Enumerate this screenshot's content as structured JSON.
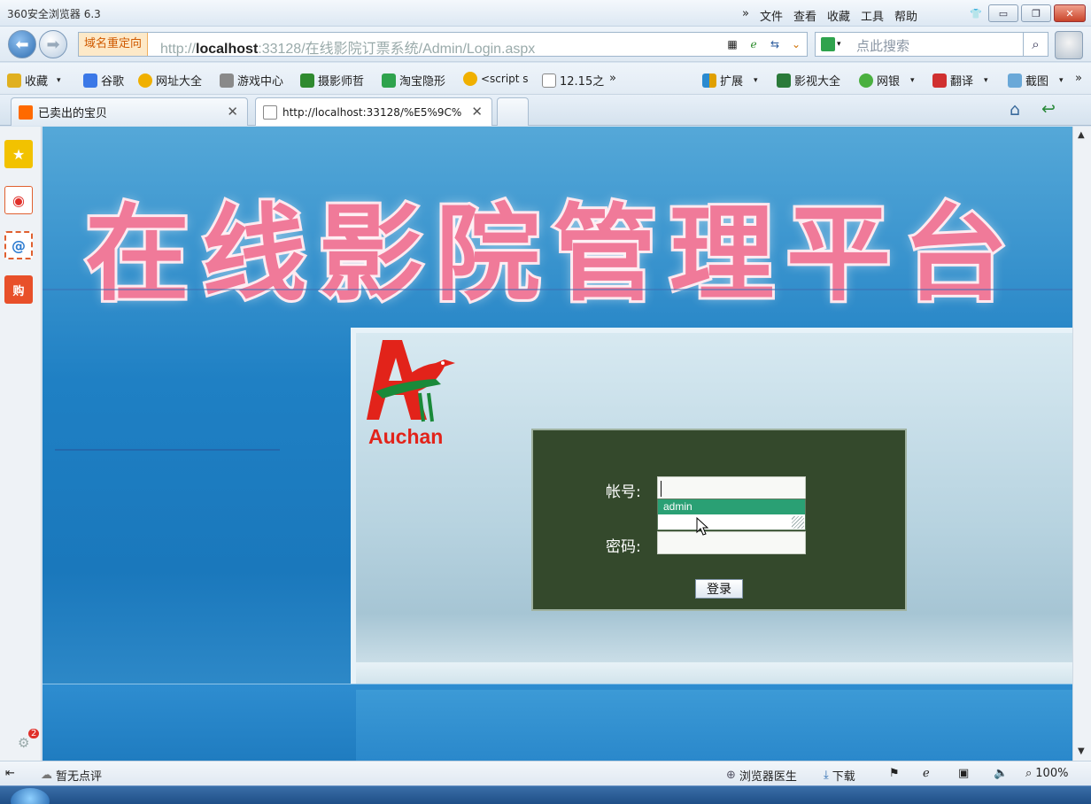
{
  "titlebar": {
    "app_title": "360安全浏览器 6.3",
    "more": "»",
    "menus": [
      "文件",
      "查看",
      "收藏",
      "工具",
      "帮助"
    ]
  },
  "address": {
    "badge": "域名重定向",
    "url_prefix": "http://",
    "url_host": "localhost",
    "url_rest": ":33128/在线影院订票系统/Admin/Login.aspx",
    "search_placeholder": "点此搜索"
  },
  "bookmarks": {
    "left": [
      "收藏",
      "谷歌",
      "网址大全",
      "游戏中心",
      "摄影师哲",
      "淘宝隐形",
      "<script s",
      "12.15之"
    ],
    "more": "»",
    "right": [
      "扩展",
      "影视大全",
      "网银",
      "翻译",
      "截图"
    ]
  },
  "tabs": [
    {
      "label": "已卖出的宝贝"
    },
    {
      "label": "http://localhost:33128/%E5%9C%"
    }
  ],
  "page": {
    "banner_title": "在线影院管理平台",
    "logo_text": "Auchan",
    "login": {
      "account_label": "帐号:",
      "password_label": "密码:",
      "autocomplete_option": "admin",
      "submit_label": "登录"
    }
  },
  "sidebar": {
    "badge_count": "2"
  },
  "statusbar": {
    "left_text": "暂无点评",
    "doctor": "浏览器医生",
    "download": "下载",
    "zoom": "100%"
  },
  "colors": {
    "banner_text": "#f07a99",
    "login_bg": "#34492c",
    "autocomplete_highlight": "#2aa074",
    "page_blue": "#1f80c4"
  }
}
